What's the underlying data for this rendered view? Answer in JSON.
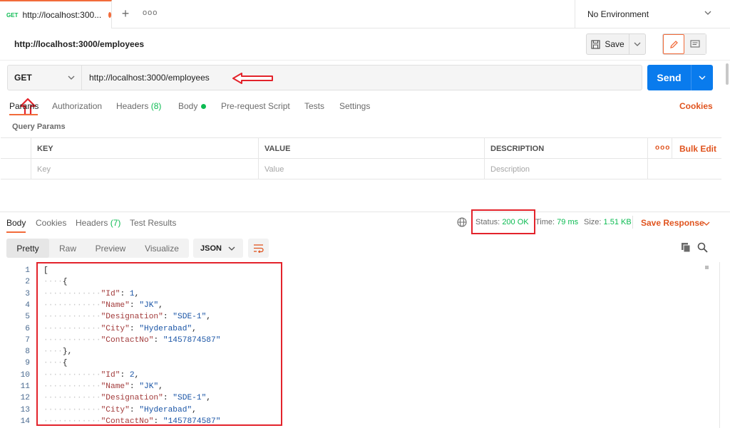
{
  "tab": {
    "method": "GET",
    "title": "http://localhost:300...",
    "unsaved_dot": true
  },
  "environment": {
    "label": "No Environment"
  },
  "request": {
    "name": "http://localhost:3000/employees",
    "method": "GET",
    "url": "http://localhost:3000/employees",
    "save_label": "Save",
    "send_label": "Send"
  },
  "request_tabs": {
    "params": "Params",
    "authorization": "Authorization",
    "headers": "Headers",
    "headers_count": "(8)",
    "body": "Body",
    "pre_request": "Pre-request Script",
    "tests": "Tests",
    "settings": "Settings",
    "cookies": "Cookies"
  },
  "query_params": {
    "label": "Query Params",
    "columns": [
      "KEY",
      "VALUE",
      "DESCRIPTION"
    ],
    "placeholders": [
      "Key",
      "Value",
      "Description"
    ],
    "bulk_edit": "Bulk Edit"
  },
  "response": {
    "tabs": {
      "body": "Body",
      "cookies": "Cookies",
      "headers": "Headers",
      "headers_count": "(7)",
      "test_results": "Test Results"
    },
    "status_label": "Status:",
    "status_value": "200 OK",
    "time_label": "Time:",
    "time_value": "79 ms",
    "size_label": "Size:",
    "size_value": "1.51 KB",
    "save_response": "Save Response",
    "views": [
      "Pretty",
      "Raw",
      "Preview",
      "Visualize"
    ],
    "format": "JSON"
  },
  "code_lines": [
    {
      "n": "1",
      "indent": 0,
      "parts": [
        [
          "p",
          "["
        ]
      ]
    },
    {
      "n": "2",
      "indent": 1,
      "parts": [
        [
          "p",
          "{"
        ]
      ]
    },
    {
      "n": "3",
      "indent": 2,
      "parts": [
        [
          "k",
          "\"Id\""
        ],
        [
          "p",
          ": "
        ],
        [
          "v",
          "1"
        ],
        [
          "p",
          ","
        ]
      ]
    },
    {
      "n": "4",
      "indent": 2,
      "parts": [
        [
          "k",
          "\"Name\""
        ],
        [
          "p",
          ": "
        ],
        [
          "v",
          "\"JK\""
        ],
        [
          "p",
          ","
        ]
      ]
    },
    {
      "n": "5",
      "indent": 2,
      "parts": [
        [
          "k",
          "\"Designation\""
        ],
        [
          "p",
          ": "
        ],
        [
          "v",
          "\"SDE-1\""
        ],
        [
          "p",
          ","
        ]
      ]
    },
    {
      "n": "6",
      "indent": 2,
      "parts": [
        [
          "k",
          "\"City\""
        ],
        [
          "p",
          ": "
        ],
        [
          "v",
          "\"Hyderabad\""
        ],
        [
          "p",
          ","
        ]
      ]
    },
    {
      "n": "7",
      "indent": 2,
      "parts": [
        [
          "k",
          "\"ContactNo\""
        ],
        [
          "p",
          ": "
        ],
        [
          "v",
          "\"1457874587\""
        ]
      ]
    },
    {
      "n": "8",
      "indent": 1,
      "parts": [
        [
          "p",
          "},"
        ]
      ]
    },
    {
      "n": "9",
      "indent": 1,
      "parts": [
        [
          "p",
          "{"
        ]
      ]
    },
    {
      "n": "10",
      "indent": 2,
      "parts": [
        [
          "k",
          "\"Id\""
        ],
        [
          "p",
          ": "
        ],
        [
          "v",
          "2"
        ],
        [
          "p",
          ","
        ]
      ]
    },
    {
      "n": "11",
      "indent": 2,
      "parts": [
        [
          "k",
          "\"Name\""
        ],
        [
          "p",
          ": "
        ],
        [
          "v",
          "\"JK\""
        ],
        [
          "p",
          ","
        ]
      ]
    },
    {
      "n": "12",
      "indent": 2,
      "parts": [
        [
          "k",
          "\"Designation\""
        ],
        [
          "p",
          ": "
        ],
        [
          "v",
          "\"SDE-1\""
        ],
        [
          "p",
          ","
        ]
      ]
    },
    {
      "n": "13",
      "indent": 2,
      "parts": [
        [
          "k",
          "\"City\""
        ],
        [
          "p",
          ": "
        ],
        [
          "v",
          "\"Hyderabad\""
        ],
        [
          "p",
          ","
        ]
      ]
    },
    {
      "n": "14",
      "indent": 2,
      "parts": [
        [
          "k",
          "\"ContactNo\""
        ],
        [
          "p",
          ": "
        ],
        [
          "v",
          "\"1457874587\""
        ]
      ]
    }
  ],
  "colors": {
    "accent": "#f26b3a",
    "send": "#097bed",
    "success": "#0cbb52",
    "annotation": "#e3232b"
  },
  "icons": [
    "plus-icon",
    "more-icon",
    "chevron-down-icon",
    "save-icon",
    "pencil-icon",
    "document-icon",
    "globe-icon",
    "wrap-icon",
    "copy-icon",
    "search-icon",
    "arrow-left-annotation-icon",
    "arrow-up-annotation-icon"
  ]
}
